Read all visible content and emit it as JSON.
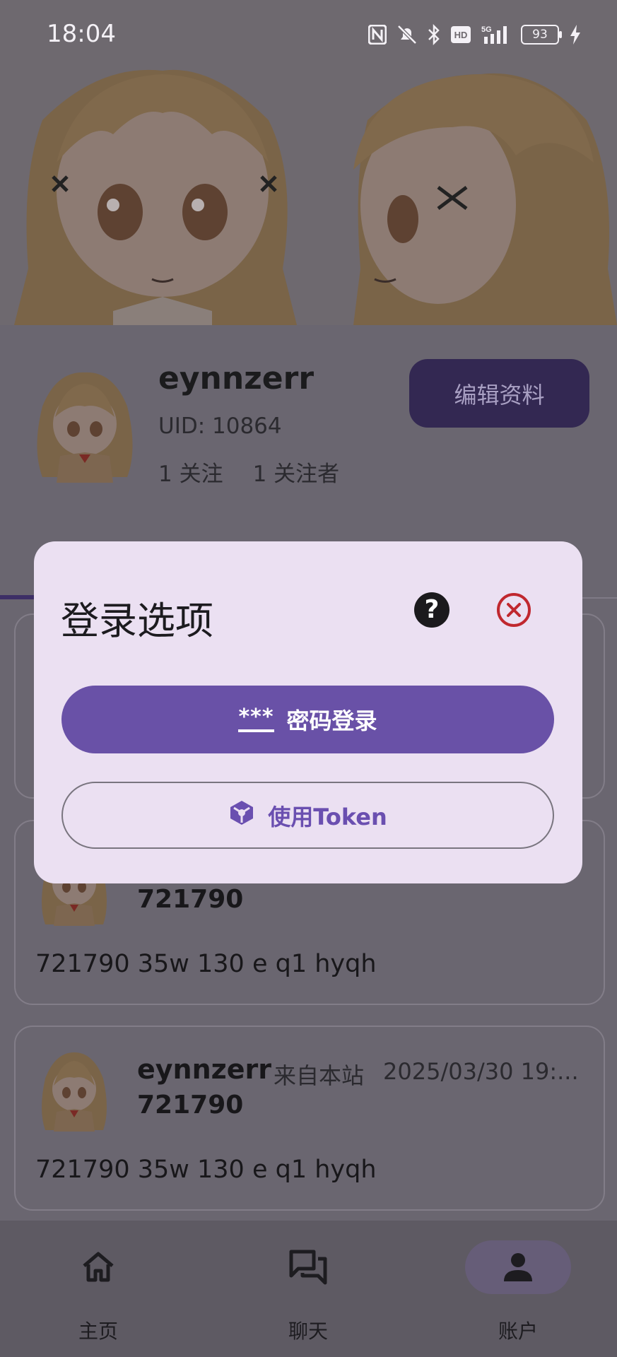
{
  "status_bar": {
    "time": "18:04",
    "battery": "93"
  },
  "profile": {
    "name": "eynnzerr",
    "uid": "UID: 10864",
    "following": "1 关注",
    "followers": "1 关注者",
    "edit_label": "编辑资料"
  },
  "posts": [
    {
      "user": "",
      "source": "",
      "date": "",
      "title": "",
      "body": ""
    },
    {
      "user": "",
      "source": "",
      "date": "",
      "title": "721790",
      "body": "721790 35w 130 e q1 hyqh"
    },
    {
      "user": "eynnzerr",
      "source": "来自本站",
      "date": "2025/03/30 19:...",
      "title": "721790",
      "body": "721790 35w 130 e q1 hyqh"
    }
  ],
  "dialog": {
    "title": "登录选项",
    "password_icon": "***",
    "password_label": "密码登录",
    "token_label": "使用Token"
  },
  "nav": [
    {
      "label": "主页",
      "icon": "home-icon"
    },
    {
      "label": "聊天",
      "icon": "chat-icon"
    },
    {
      "label": "账户",
      "icon": "account-icon"
    }
  ],
  "colors": {
    "scrim_bg": "#6a6670",
    "dialog_bg": "#ebe0f2",
    "primary": "#6951a7",
    "close_red": "#c0282f"
  }
}
